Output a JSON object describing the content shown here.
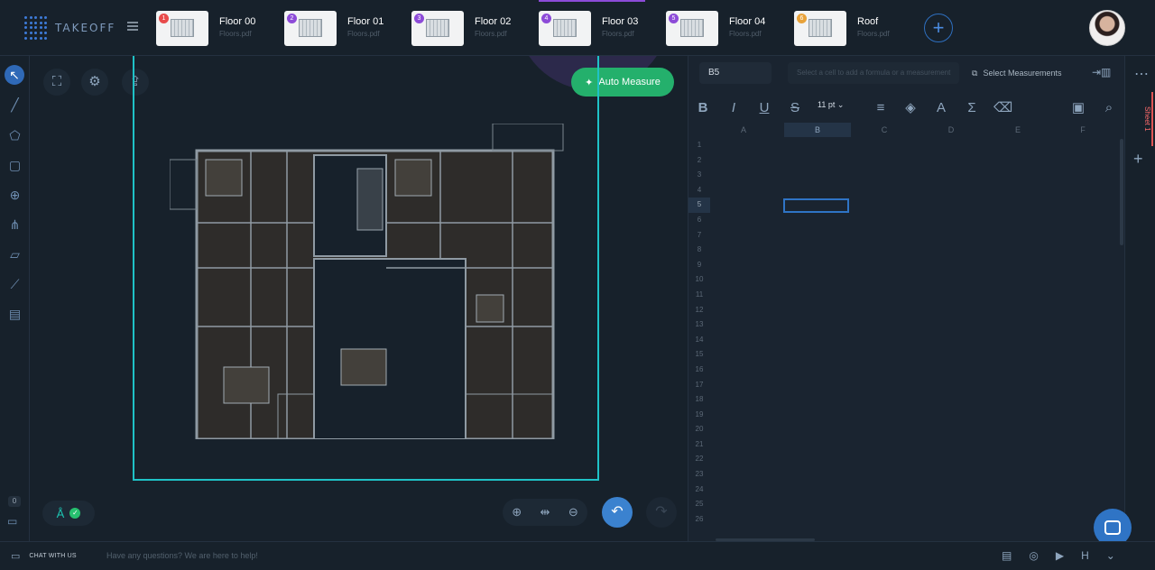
{
  "app": {
    "logo_text": "TAKEOFF"
  },
  "floors": [
    {
      "title": "Floor 00",
      "file": "Floors.pdf",
      "badge": "1",
      "badge_color": "#e84b4b"
    },
    {
      "title": "Floor 01",
      "file": "Floors.pdf",
      "badge": "2",
      "badge_color": "#8d4bd8"
    },
    {
      "title": "Floor 02",
      "file": "Floors.pdf",
      "badge": "3",
      "badge_color": "#8d4bd8"
    },
    {
      "title": "Floor 03",
      "file": "Floors.pdf",
      "badge": "4",
      "badge_color": "#8d4bd8"
    },
    {
      "title": "Floor 04",
      "file": "Floors.pdf",
      "badge": "5",
      "badge_color": "#8d4bd8"
    },
    {
      "title": "Roof",
      "file": "Floors.pdf",
      "badge": "6",
      "badge_color": "#e8a23a"
    }
  ],
  "canvas": {
    "auto_measure": "Auto Measure",
    "status_count": "0"
  },
  "sheet": {
    "cell_ref": "B5",
    "formula_placeholder": "Select a cell to add a formula or a measurement",
    "select_measurements": "Select Measurements",
    "font_size": "11 pt",
    "columns": [
      "A",
      "B",
      "C",
      "D",
      "E",
      "F"
    ],
    "rows": [
      "1",
      "2",
      "3",
      "4",
      "5",
      "6",
      "7",
      "8",
      "9",
      "10",
      "11",
      "12",
      "13",
      "14",
      "15",
      "16",
      "17",
      "18",
      "19",
      "20",
      "21",
      "22",
      "23",
      "24",
      "25",
      "26"
    ],
    "sheet_name": "Sheet 1"
  },
  "footer": {
    "chat_label": "CHAT WITH US",
    "help_text": "Have any questions? We are here to help!"
  },
  "colors": {
    "background": "#17212b",
    "accent_blue": "#2f74c5",
    "accent_green": "#24b06c",
    "accent_cyan": "#1fc2c7",
    "active_tab": "#8c4bd8"
  }
}
